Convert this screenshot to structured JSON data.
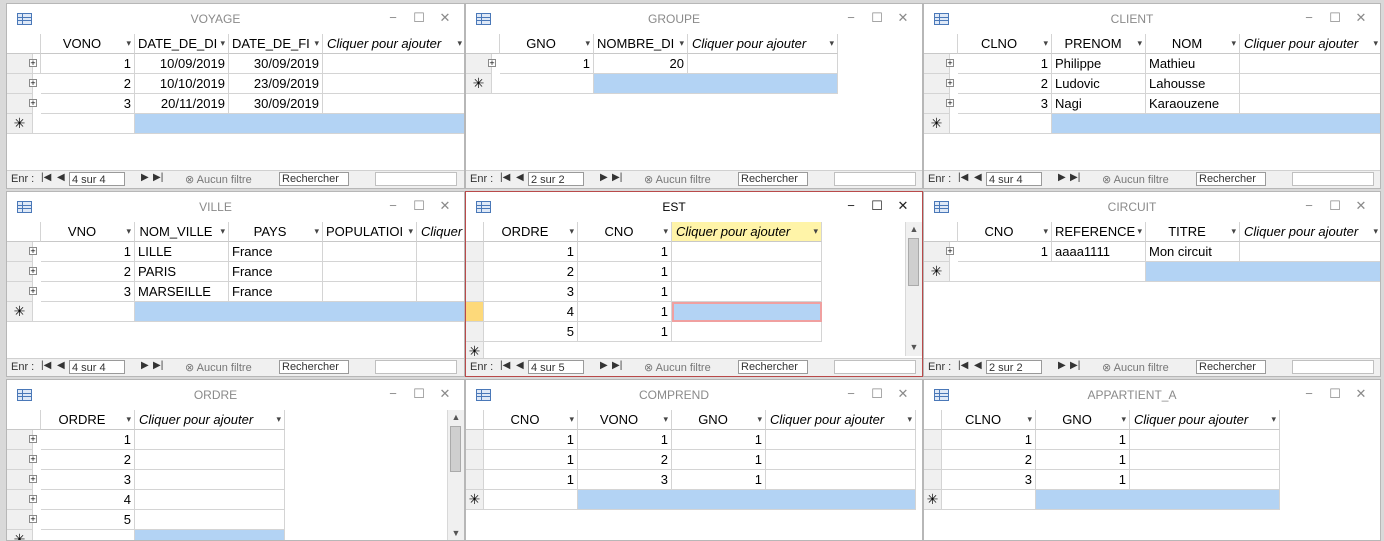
{
  "voyage": {
    "title": "VOYAGE",
    "columns": [
      "VONO",
      "DATE_DE_DI",
      "DATE_DE_FI",
      "Cliquer pour ajouter"
    ],
    "rows": [
      [
        "1",
        "10/09/2019",
        "30/09/2019"
      ],
      [
        "2",
        "10/10/2019",
        "23/09/2019"
      ],
      [
        "3",
        "20/11/2019",
        "30/09/2019"
      ]
    ],
    "nav": {
      "label": "Enr :",
      "record": "4 sur 4",
      "filter": "Aucun filtre",
      "search": "Rechercher"
    }
  },
  "groupe": {
    "title": "GROUPE",
    "columns": [
      "GNO",
      "NOMBRE_DI",
      "Cliquer pour ajouter"
    ],
    "rows": [
      [
        "1",
        "20"
      ]
    ],
    "nav": {
      "label": "Enr :",
      "record": "2 sur 2",
      "filter": "Aucun filtre",
      "search": "Rechercher"
    }
  },
  "client": {
    "title": "CLIENT",
    "columns": [
      "CLNO",
      "PRENOM",
      "NOM",
      "Cliquer pour ajouter"
    ],
    "rows": [
      [
        "1",
        "Philippe",
        "Mathieu"
      ],
      [
        "2",
        "Ludovic",
        "Lahousse"
      ],
      [
        "3",
        "Nagi",
        "Karaouzene"
      ]
    ],
    "nav": {
      "label": "Enr :",
      "record": "4 sur 4",
      "filter": "Aucun filtre",
      "search": "Rechercher"
    }
  },
  "ville": {
    "title": "VILLE",
    "columns": [
      "VNO",
      "NOM_VILLE",
      "PAYS",
      "POPULATIOI",
      "Cliquer"
    ],
    "rows": [
      [
        "1",
        "LILLE",
        "France"
      ],
      [
        "2",
        "PARIS",
        "France"
      ],
      [
        "3",
        "MARSEILLE",
        "France"
      ]
    ],
    "nav": {
      "label": "Enr :",
      "record": "4 sur 4",
      "filter": "Aucun filtre",
      "search": "Rechercher"
    }
  },
  "est": {
    "title": "EST",
    "columns": [
      "ORDRE",
      "CNO",
      "Cliquer pour ajouter"
    ],
    "rows": [
      [
        "1",
        "1"
      ],
      [
        "2",
        "1"
      ],
      [
        "3",
        "1"
      ],
      [
        "4",
        "1"
      ],
      [
        "5",
        "1"
      ]
    ],
    "nav": {
      "label": "Enr :",
      "record": "4 sur 5",
      "filter": "Aucun filtre",
      "search": "Rechercher"
    }
  },
  "circuit": {
    "title": "CIRCUIT",
    "columns": [
      "CNO",
      "REFERENCE",
      "TITRE",
      "Cliquer pour ajouter"
    ],
    "rows": [
      [
        "1",
        "aaaa1111",
        "Mon circuit"
      ]
    ],
    "nav": {
      "label": "Enr :",
      "record": "2 sur 2",
      "filter": "Aucun filtre",
      "search": "Rechercher"
    }
  },
  "ordre": {
    "title": "ORDRE",
    "columns": [
      "ORDRE",
      "Cliquer pour ajouter"
    ],
    "rows": [
      [
        "1"
      ],
      [
        "2"
      ],
      [
        "3"
      ],
      [
        "4"
      ],
      [
        "5"
      ]
    ]
  },
  "comprend": {
    "title": "COMPREND",
    "columns": [
      "CNO",
      "VONO",
      "GNO",
      "Cliquer pour ajouter"
    ],
    "rows": [
      [
        "1",
        "1",
        "1"
      ],
      [
        "1",
        "2",
        "1"
      ],
      [
        "1",
        "3",
        "1"
      ]
    ]
  },
  "appartient": {
    "title": "APPARTIENT_A",
    "columns": [
      "CLNO",
      "GNO",
      "Cliquer pour ajouter"
    ],
    "rows": [
      [
        "1",
        "1"
      ],
      [
        "2",
        "1"
      ],
      [
        "3",
        "1"
      ]
    ]
  },
  "glyphs": {
    "new_row": "✳",
    "minimize": "−",
    "maximize": "☐",
    "close": "✕",
    "expand": "+",
    "dropdown": "▾",
    "first": "|◀",
    "prev": "◀",
    "next": "▶",
    "last": "▶|",
    "new": "▶✱",
    "left": "◀",
    "right": "▶",
    "up": "▲",
    "down": "▼",
    "filter_icon": "⊗"
  },
  "colors": {
    "selection": "#b3d3f4",
    "current_row": "#fdd97a",
    "active_border": "#b94a4a",
    "header_highlight": "#fff4a8"
  }
}
